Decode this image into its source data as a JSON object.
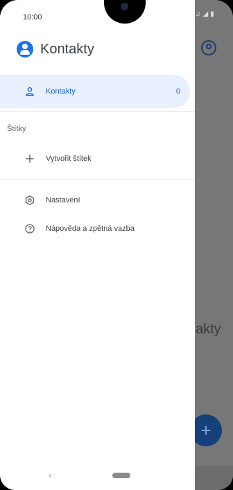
{
  "status_bar": {
    "time": "10:00"
  },
  "drawer": {
    "app_title": "Kontakty",
    "items": [
      {
        "label": "Kontakty",
        "count": "0",
        "icon": "person-icon",
        "active": true
      }
    ],
    "labels_section": {
      "title": "Štítky",
      "create_label": "Vytvořit štítek"
    },
    "settings": "Nastavení",
    "help": "Nápověda a zpětná vazba"
  },
  "background_app": {
    "visible_text": "akty",
    "fab_symbol": "+"
  },
  "colors": {
    "accent": "#1a73e8",
    "active_bg": "#e8f0fe",
    "active_text": "#1967d2"
  }
}
